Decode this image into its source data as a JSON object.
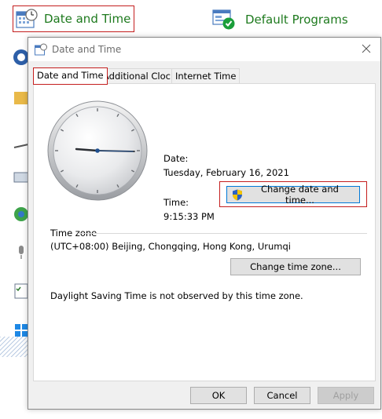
{
  "control_panel": {
    "items": [
      {
        "label": "Date and Time",
        "icon": "calendar-clock-icon"
      },
      {
        "label": "Default Programs",
        "icon": "default-programs-icon"
      }
    ]
  },
  "dialog": {
    "title": "Date and Time",
    "tabs": [
      {
        "label": "Date and Time",
        "selected": true
      },
      {
        "label": "Additional Clocks",
        "selected": false
      },
      {
        "label": "Internet Time",
        "selected": false
      }
    ],
    "date_label": "Date:",
    "date_value": "Tuesday, February 16, 2021",
    "time_label": "Time:",
    "time_value": "9:15:33 PM",
    "change_datetime_button": "Change date and time...",
    "timezone_heading": "Time zone",
    "timezone_value": "(UTC+08:00) Beijing, Chongqing, Hong Kong, Urumqi",
    "change_timezone_button": "Change time zone...",
    "dst_note": "Daylight Saving Time is not observed by this time zone.",
    "buttons": {
      "ok": "OK",
      "cancel": "Cancel",
      "apply": "Apply"
    }
  },
  "colors": {
    "accent_red": "#c41e1e",
    "link_green": "#1e7a1e",
    "focus_blue": "#0078d7"
  }
}
